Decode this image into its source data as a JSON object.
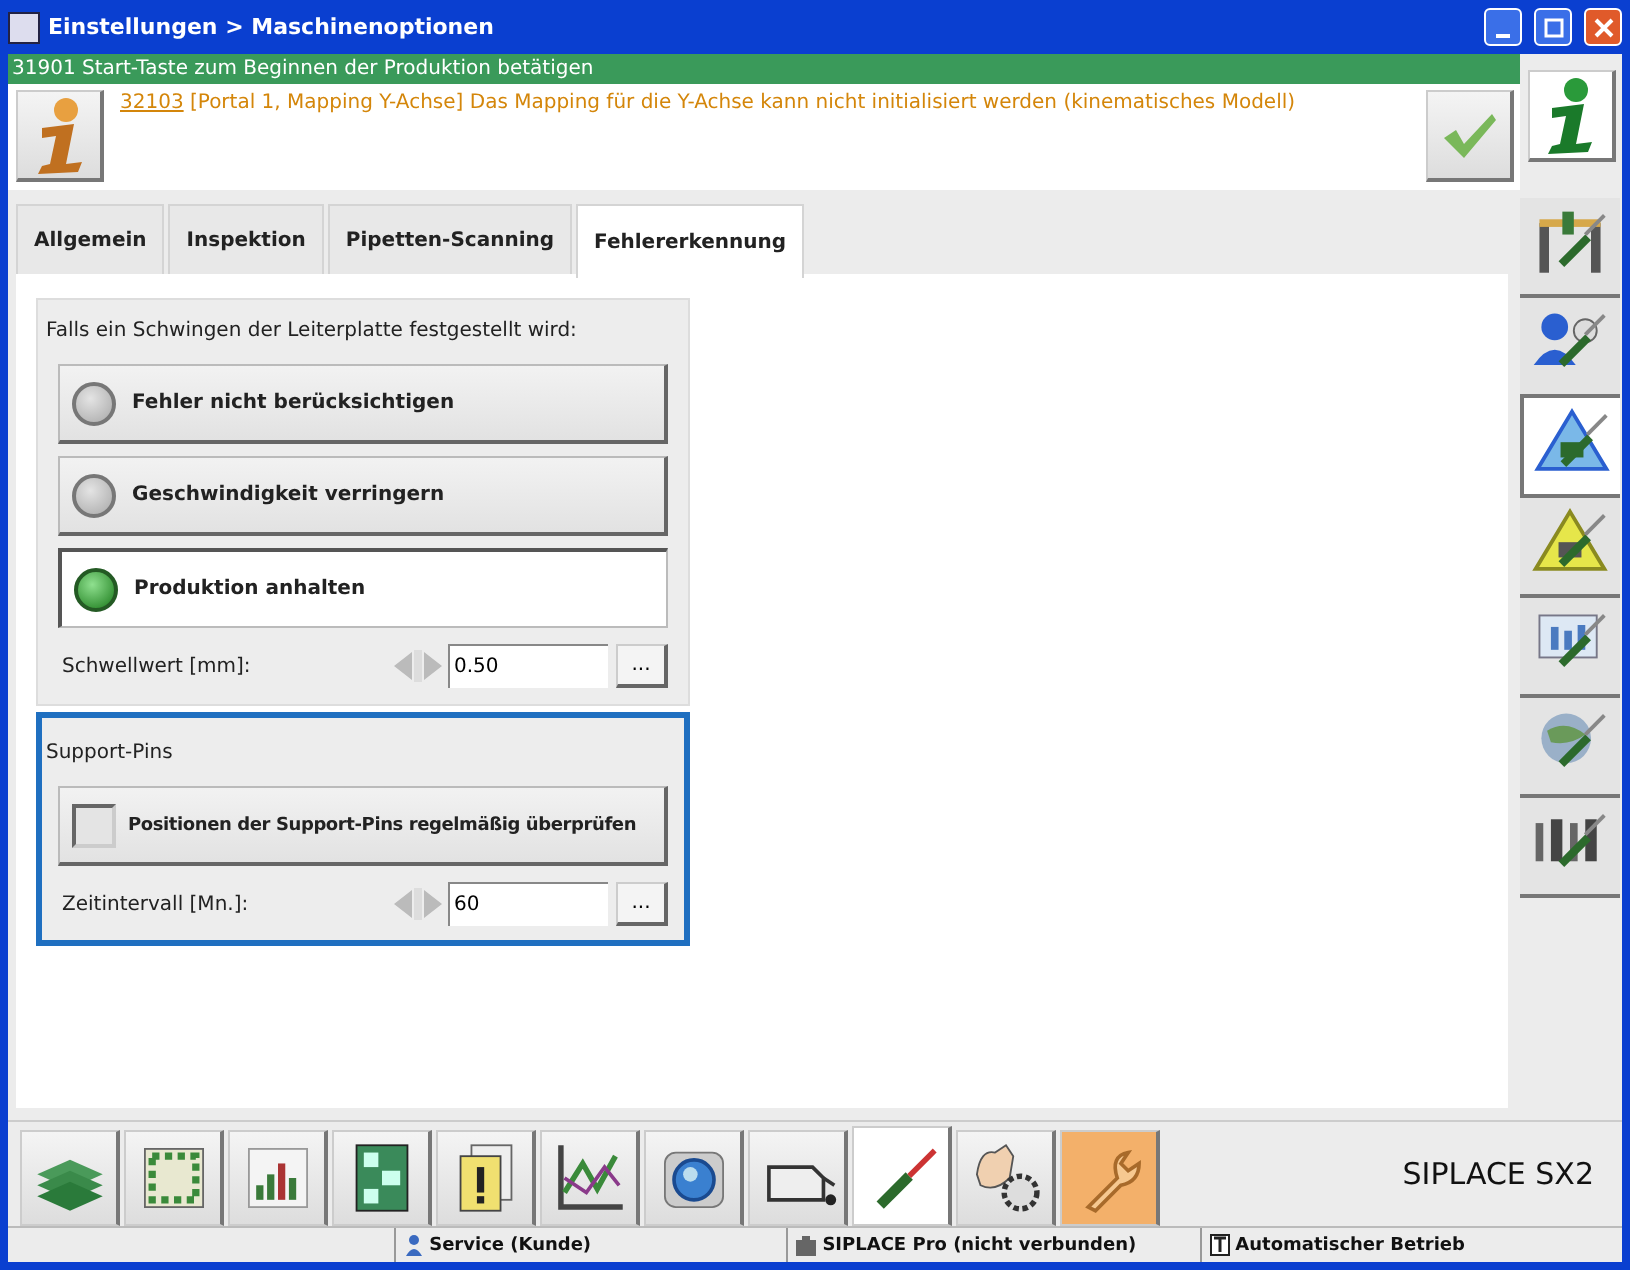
{
  "window": {
    "title": "Einstellungen > Maschinenoptionen"
  },
  "status_message": "31901 Start-Taste zum Beginnen der Produktion betätigen",
  "message": {
    "code": "32103",
    "text": "[Portal 1, Mapping Y-Achse] Das Mapping für die Y-Achse kann nicht initialisiert werden (kinematisches Modell)"
  },
  "tabs": [
    {
      "label": "Allgemein",
      "selected": false
    },
    {
      "label": "Inspektion",
      "selected": false
    },
    {
      "label": "Pipetten-Scanning",
      "selected": false
    },
    {
      "label": "Fehlererkennung",
      "selected": true
    }
  ],
  "oscillation_group": {
    "title": "Falls ein Schwingen der Leiterplatte festgestellt wird:",
    "options": [
      {
        "label": "Fehler nicht berücksichtigen",
        "selected": false
      },
      {
        "label": "Geschwindigkeit verringern",
        "selected": false
      },
      {
        "label": "Produktion anhalten",
        "selected": true
      }
    ],
    "field": {
      "label": "Schwellwert [mm]:",
      "value": "0.50",
      "button": "..."
    }
  },
  "support_pins_group": {
    "title": "Support-Pins",
    "focused": true,
    "checkbox": {
      "label": "Positionen der Support-Pins regelmäßig überprüfen",
      "checked": false
    },
    "field": {
      "label": "Zeitintervall [Mn.]:",
      "value": "60",
      "button": "..."
    }
  },
  "sidebar": {
    "items": [
      {
        "selected": false
      },
      {
        "selected": false
      },
      {
        "selected": true
      },
      {
        "selected": false
      },
      {
        "selected": false
      },
      {
        "selected": false
      },
      {
        "selected": false
      }
    ]
  },
  "toolbar": {
    "items": [
      {
        "selected": false,
        "highlighted": false
      },
      {
        "selected": false,
        "highlighted": false
      },
      {
        "selected": false,
        "highlighted": false
      },
      {
        "selected": false,
        "highlighted": false
      },
      {
        "selected": false,
        "highlighted": false
      },
      {
        "selected": false,
        "highlighted": false
      },
      {
        "selected": false,
        "highlighted": false
      },
      {
        "selected": false,
        "highlighted": false
      },
      {
        "selected": true,
        "highlighted": false
      },
      {
        "selected": false,
        "highlighted": false
      },
      {
        "selected": false,
        "highlighted": true
      }
    ]
  },
  "brand": "SIPLACE SX2",
  "status_bar": [
    {
      "text": "Service (Kunde)"
    },
    {
      "text": "SIPLACE Pro (nicht verbunden)"
    },
    {
      "text": "Automatischer Betrieb"
    }
  ]
}
